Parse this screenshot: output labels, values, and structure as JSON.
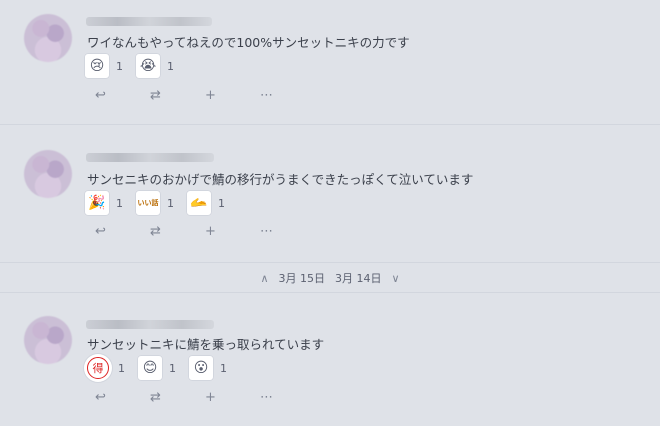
{
  "notes": [
    {
      "text": "ワイなんもやってねえので100%サンセットニキの力です",
      "reactions": [
        {
          "emoji_name": "helmet-crying-icon",
          "glyph": "😢",
          "count": "1"
        },
        {
          "emoji_name": "helmet-crying-2-icon",
          "glyph": "😭",
          "count": "1"
        }
      ]
    },
    {
      "text": "サンセニキのおかげで鯖の移行がうまくできたっぽくて泣いています",
      "reactions": [
        {
          "emoji_name": "party-popper-icon",
          "glyph": "🎉",
          "count": "1"
        },
        {
          "emoji_name": "iihanashi-text-icon",
          "glyph": "いい話",
          "count": "1"
        },
        {
          "emoji_name": "hand-emoji-icon",
          "glyph": "🫴",
          "count": "1"
        }
      ]
    },
    {
      "text": "サンセットニキに鯖を乗っ取られています",
      "reactions": [
        {
          "emoji_name": "toku-kanji-icon",
          "glyph": "得",
          "count": "1"
        },
        {
          "emoji_name": "smiling-face-icon",
          "glyph": "😊",
          "count": "1"
        },
        {
          "emoji_name": "surprised-face-icon",
          "glyph": "😮",
          "count": "1"
        }
      ]
    }
  ],
  "actions": {
    "reply": "↩",
    "renote": "⇄",
    "react": "+",
    "more": "⋯"
  },
  "date_separator": {
    "up_icon": "∧",
    "prev_date": "3月 15日",
    "next_date": "3月 14日",
    "down_icon": "∨"
  }
}
